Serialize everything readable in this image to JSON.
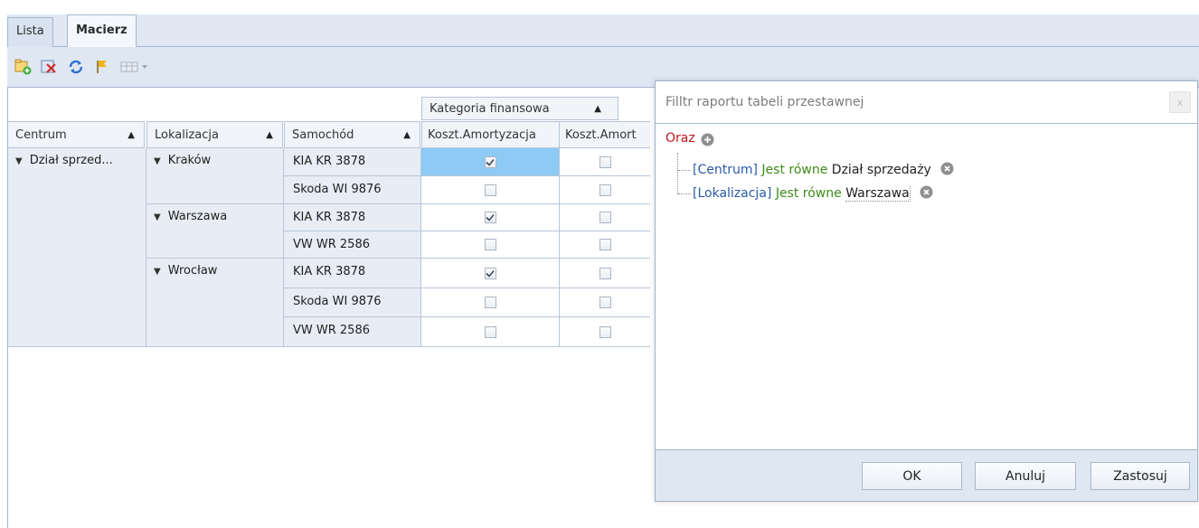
{
  "tabs": [
    {
      "label": "Lista",
      "active": false
    },
    {
      "label": "Macierz",
      "active": true
    }
  ],
  "toolbar": {
    "icons": [
      "add-icon",
      "delete-icon",
      "refresh-icon",
      "flag-icon",
      "layout-dropdown-icon"
    ]
  },
  "grid": {
    "column_group_header": "Kategoria finansowa",
    "row_headers": [
      "Centrum",
      "Lokalizacja",
      "Samochód"
    ],
    "value_columns": [
      "Koszt.Amortyzacja",
      "Koszt.Amort"
    ],
    "centrum": "Dział sprzed...",
    "locations": [
      {
        "name": "Kraków",
        "cars": [
          {
            "car": "KIA KR 3878",
            "values": [
              true,
              false
            ]
          },
          {
            "car": "Skoda WI 9876",
            "values": [
              false,
              false
            ]
          }
        ]
      },
      {
        "name": "Warszawa",
        "cars": [
          {
            "car": "KIA KR 3878",
            "values": [
              true,
              false
            ]
          },
          {
            "car": "VW WR 2586",
            "values": [
              false,
              false
            ]
          }
        ]
      },
      {
        "name": "Wrocław",
        "cars": [
          {
            "car": "KIA KR 3878",
            "values": [
              true,
              false
            ]
          },
          {
            "car": "Skoda WI 9876",
            "values": [
              false,
              false
            ]
          },
          {
            "car": "VW WR 2586",
            "values": [
              false,
              false
            ]
          }
        ]
      }
    ]
  },
  "filter_dialog": {
    "title": "Filltr raportu tabeli przestawnej",
    "close_label": "x",
    "group_operator": "Oraz",
    "conditions": [
      {
        "field": "[Centrum]",
        "operator": "Jest równe",
        "value": "Dział sprzedaży"
      },
      {
        "field": "[Lokalizacja]",
        "operator": "Jest równe",
        "value": "Warszawa"
      }
    ],
    "buttons": {
      "ok": "OK",
      "cancel": "Anuluj",
      "apply": "Zastosuj"
    }
  },
  "colors": {
    "selection": "#8ecbf4",
    "operator_red": "#c4141c",
    "field_blue": "#2a5ba8",
    "condition_green": "#3d8b19"
  }
}
